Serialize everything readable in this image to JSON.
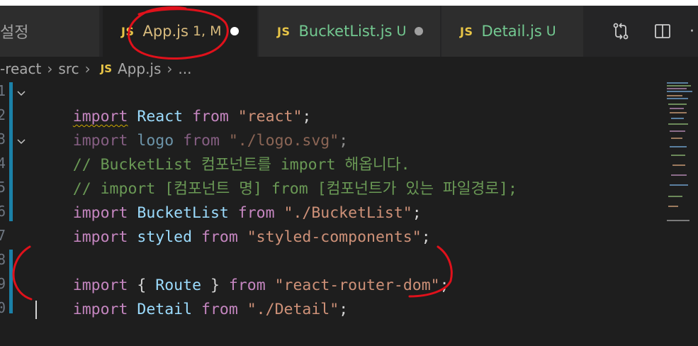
{
  "tabs": [
    {
      "id": "prev",
      "label": "설정",
      "active": false
    },
    {
      "id": "app",
      "icon": "JS",
      "label": "App.js",
      "status": "1, M",
      "active": true,
      "modified": true,
      "color": "#d7ba7d"
    },
    {
      "id": "bucket",
      "icon": "JS",
      "label": "BucketList.js",
      "status": "U",
      "active": false,
      "modified": true,
      "color": "#73c991"
    },
    {
      "id": "detail",
      "icon": "JS",
      "label": "Detail.js",
      "status": "U",
      "active": false,
      "modified": false,
      "color": "#73c991"
    }
  ],
  "tab_actions": [
    "source-control-compare-icon",
    "split-editor-icon",
    "more-actions-icon"
  ],
  "breadcrumb": {
    "root": "-react",
    "folder": "src",
    "file_icon": "JS",
    "file": "App.js",
    "more": "..."
  },
  "gutter_numbers": [
    "1",
    "2",
    "3",
    "4",
    "5",
    "6",
    "7",
    "8",
    "9",
    "0"
  ],
  "code": {
    "l1": {
      "a": "import",
      "b": " React ",
      "c": "from",
      "d": " \"react\"",
      "e": ";"
    },
    "l2": {
      "a": "import",
      "b": " logo ",
      "c": "from",
      "d": " \"./logo.svg\"",
      "e": ";"
    },
    "l3": {
      "a": "// BucketList 컴포넌트를 import 해옵니다."
    },
    "l4": {
      "a": "// import [컴포넌트 명] from [컴포넌트가 있는 파일경로];"
    },
    "l5": {
      "a": "import",
      "b": " BucketList ",
      "c": "from",
      "d": " \"./BucketList\"",
      "e": ";"
    },
    "l6": {
      "a": "import",
      "b": " styled ",
      "c": "from",
      "d": " \"styled-components\"",
      "e": ";"
    },
    "l8": {
      "a": "import",
      "b1": " { ",
      "b": "Route",
      "b2": " } ",
      "c": "from",
      "d": " \"react-router-dom\"",
      "e": ";"
    },
    "l9": {
      "a": "import",
      "b": " Detail ",
      "c": "from",
      "d": " \"./Detail\"",
      "e": ";"
    }
  },
  "colors": {
    "keyword": "#c586c0",
    "identifier": "#9cdcfe",
    "string": "#ce9178",
    "comment": "#6a9955",
    "modified_tab": "#d7ba7d",
    "untracked_tab": "#73c991",
    "annotation": "#e0111b"
  }
}
